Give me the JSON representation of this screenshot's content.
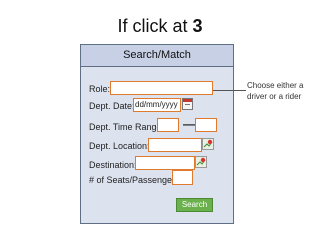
{
  "slide": {
    "title_prefix": "If click at ",
    "title_number": "3"
  },
  "form": {
    "header": "Search/Match",
    "role_label": "Role:",
    "dept_date_label": "Dept. Date:",
    "dept_date_value": "dd/mm/yyyy",
    "dept_time_label": "Dept. Time Range:",
    "time_separator": "—",
    "dept_location_label": "Dept. Location:",
    "destination_label": "Destination:",
    "seats_label": "# of Seats/Passengers:",
    "search_button": "Search"
  },
  "callout": {
    "line1": "Choose either a",
    "line2": "driver or a rider"
  },
  "colors": {
    "field_border": "#e07a2e",
    "button": "#6ab04c",
    "panel": "#dde2ef",
    "header": "#c7d0e4"
  },
  "icons": {
    "date_picker": "calendar-icon",
    "location_picker": "map-pin-icon",
    "destination_picker": "map-pin-icon"
  }
}
